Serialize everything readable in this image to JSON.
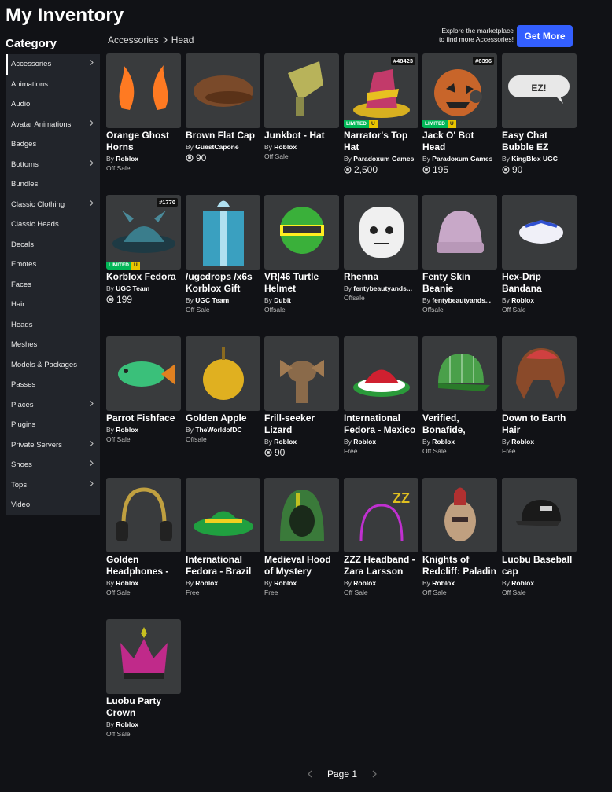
{
  "page_title": "My Inventory",
  "category_heading": "Category",
  "breadcrumb": [
    "Accessories",
    "Head"
  ],
  "promo": {
    "line1": "Explore the marketplace",
    "line2": "to find more Accessories!",
    "button": "Get More"
  },
  "sidebar": [
    {
      "label": "Accessories",
      "chevron": true,
      "active": true
    },
    {
      "label": "Animations",
      "chevron": false
    },
    {
      "label": "Audio",
      "chevron": false
    },
    {
      "label": "Avatar Animations",
      "chevron": true
    },
    {
      "label": "Badges",
      "chevron": false
    },
    {
      "label": "Bottoms",
      "chevron": true
    },
    {
      "label": "Bundles",
      "chevron": false
    },
    {
      "label": "Classic Clothing",
      "chevron": true
    },
    {
      "label": "Classic Heads",
      "chevron": false
    },
    {
      "label": "Decals",
      "chevron": false
    },
    {
      "label": "Emotes",
      "chevron": false
    },
    {
      "label": "Faces",
      "chevron": false
    },
    {
      "label": "Hair",
      "chevron": false
    },
    {
      "label": "Heads",
      "chevron": false
    },
    {
      "label": "Meshes",
      "chevron": false
    },
    {
      "label": "Models & Packages",
      "chevron": false
    },
    {
      "label": "Passes",
      "chevron": false
    },
    {
      "label": "Places",
      "chevron": true
    },
    {
      "label": "Plugins",
      "chevron": false
    },
    {
      "label": "Private Servers",
      "chevron": true
    },
    {
      "label": "Shoes",
      "chevron": true
    },
    {
      "label": "Tops",
      "chevron": true
    },
    {
      "label": "Video",
      "chevron": false
    }
  ],
  "items": [
    {
      "name": "Orange Ghost Horns",
      "by": "By",
      "creator": "Roblox",
      "price": "Off Sale",
      "robux": false,
      "icon": "orange-horns-icon",
      "color": "#ff7a22"
    },
    {
      "name": "Brown Flat Cap",
      "by": "By",
      "creator": "GuestCapone",
      "price": "90",
      "robux": true,
      "icon": "flat-cap-icon",
      "color": "#7a4a2a"
    },
    {
      "name": "Junkbot - Hat",
      "by": "By",
      "creator": "Roblox",
      "price": "Off Sale",
      "robux": false,
      "icon": "junkbot-hat-icon",
      "color": "#b8b35a"
    },
    {
      "name": "Narrator's Top Hat",
      "by": "By",
      "creator": "Paradoxum Games",
      "price": "2,500",
      "robux": true,
      "serial": "#48423",
      "limited": true,
      "icon": "top-hat-icon",
      "color": "#c23a6a"
    },
    {
      "name": "Jack O' Bot Head",
      "by": "By",
      "creator": "Paradoxum Games",
      "price": "195",
      "robux": true,
      "serial": "#6396",
      "limited": true,
      "icon": "pumpkin-head-icon",
      "color": "#c8652a"
    },
    {
      "name": "Easy Chat Bubble EZ",
      "by": "By",
      "creator": "KingBlox UGC",
      "price": "90",
      "robux": true,
      "icon": "chat-bubble-icon",
      "color": "#e8e8e8"
    },
    {
      "name": "Korblox Fedora",
      "by": "By",
      "creator": "UGC Team",
      "price": "199",
      "robux": true,
      "serial": "#1770",
      "limited": true,
      "icon": "korblox-fedora-icon",
      "color": "#3a7d8c"
    },
    {
      "name": "/ugcdrops /x6s Korblox Gift",
      "by": "By",
      "creator": "UGC Team",
      "price": "Off Sale",
      "robux": false,
      "icon": "gift-box-icon",
      "color": "#3aa0c0"
    },
    {
      "name": "VR|46 Turtle Helmet",
      "by": "By",
      "creator": "Dubit",
      "price": "Offsale",
      "robux": false,
      "icon": "helmet-icon",
      "color": "#3ab03a"
    },
    {
      "name": "Rhenna",
      "by": "By",
      "creator": "fentybeautyands...",
      "price": "Offsale",
      "robux": false,
      "icon": "face-head-icon",
      "color": "#f0f0f0"
    },
    {
      "name": "Fenty Skin Beanie",
      "by": "By",
      "creator": "fentybeautyands...",
      "price": "Offsale",
      "robux": false,
      "icon": "beanie-icon",
      "color": "#c8a8c8"
    },
    {
      "name": "Hex-Drip Bandana",
      "by": "By",
      "creator": "Roblox",
      "price": "Off Sale",
      "robux": false,
      "icon": "bandana-icon",
      "color": "#f0f0f8"
    },
    {
      "name": "Parrot Fishface",
      "by": "By",
      "creator": "Roblox",
      "price": "Off Sale",
      "robux": false,
      "icon": "fish-icon",
      "color": "#3ac07a"
    },
    {
      "name": "Golden Apple",
      "by": "By",
      "creator": "TheWorldofDC",
      "price": "Offsale",
      "robux": false,
      "icon": "golden-apple-icon",
      "color": "#e0b020"
    },
    {
      "name": "Frill-seeker Lizard",
      "by": "By",
      "creator": "Roblox",
      "price": "90",
      "robux": true,
      "icon": "lizard-icon",
      "color": "#8a6a4a"
    },
    {
      "name": "International Fedora - Mexico",
      "by": "By",
      "creator": "Roblox",
      "price": "Free",
      "robux": false,
      "icon": "mexico-fedora-icon",
      "color": "#d02030"
    },
    {
      "name": "Verified, Bonafide, Plaidafied",
      "by": "By",
      "creator": "Roblox",
      "price": "Off Sale",
      "robux": false,
      "icon": "plaid-cap-icon",
      "color": "#4aa04a"
    },
    {
      "name": "Down to Earth Hair",
      "by": "By",
      "creator": "Roblox",
      "price": "Free",
      "robux": false,
      "icon": "hair-icon",
      "color": "#8a4a2a"
    },
    {
      "name": "Golden Headphones - Zara",
      "by": "By",
      "creator": "Roblox",
      "price": "Off Sale",
      "robux": false,
      "icon": "headphones-icon",
      "color": "#c0a040"
    },
    {
      "name": "International Fedora - Brazil",
      "by": "By",
      "creator": "Roblox",
      "price": "Free",
      "robux": false,
      "icon": "brazil-fedora-icon",
      "color": "#20a040"
    },
    {
      "name": "Medieval Hood of Mystery",
      "by": "By",
      "creator": "Roblox",
      "price": "Free",
      "robux": false,
      "icon": "hood-icon",
      "color": "#3a7a3a"
    },
    {
      "name": "ZZZ Headband - Zara Larsson",
      "by": "By",
      "creator": "Roblox",
      "price": "Off Sale",
      "robux": false,
      "icon": "headband-icon",
      "color": "#c030d0"
    },
    {
      "name": "Knights of Redcliff: Paladin",
      "by": "By",
      "creator": "Roblox",
      "price": "Off Sale",
      "robux": false,
      "icon": "knight-helmet-icon",
      "color": "#b03030"
    },
    {
      "name": "Luobu Baseball cap",
      "by": "By",
      "creator": "Roblox",
      "price": "Off Sale",
      "robux": false,
      "icon": "baseball-cap-icon",
      "color": "#1a1a1a"
    },
    {
      "name": "Luobu Party Crown",
      "by": "By",
      "creator": "Roblox",
      "price": "Off Sale",
      "robux": false,
      "icon": "crown-icon",
      "color": "#c02a8a"
    }
  ],
  "limited_badge": {
    "label": "LIMITED",
    "unique": "U"
  },
  "pagination": {
    "label": "Page 1"
  }
}
